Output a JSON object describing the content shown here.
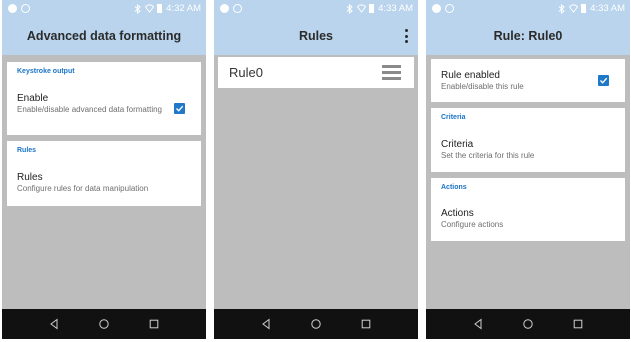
{
  "status_bar": {
    "time_1": "4:32 AM",
    "time_2": "4:33 AM",
    "time_3": "4:33 AM"
  },
  "screen1": {
    "title": "Advanced data formatting",
    "keystroke_section": "Keystroke output",
    "enable_title": "Enable",
    "enable_summary": "Enable/disable advanced data formatting",
    "enable_checked": true,
    "rules_section": "Rules",
    "rules_title": "Rules",
    "rules_summary": "Configure rules for data manipulation"
  },
  "screen2": {
    "title": "Rules",
    "rules": [
      "Rule0"
    ]
  },
  "screen3": {
    "title": "Rule: Rule0",
    "rule_enabled_title": "Rule enabled",
    "rule_enabled_summary": "Enable/disable this rule",
    "rule_enabled_checked": true,
    "criteria_section": "Criteria",
    "criteria_title": "Criteria",
    "criteria_summary": "Set the criteria for this rule",
    "actions_section": "Actions",
    "actions_title": "Actions",
    "actions_summary": "Configure actions"
  },
  "icons": {
    "status_left": [
      "notification-icon",
      "sync-icon"
    ],
    "status_right": [
      "bluetooth-icon",
      "wifi-icon",
      "battery-icon"
    ],
    "nav": [
      "back-icon",
      "home-icon",
      "recent-apps-icon"
    ],
    "overflow": "more-vert-icon",
    "drag": "drag-handle-icon",
    "check": "checkbox-checked-icon"
  },
  "colors": {
    "app_bar": "#b9d4ec",
    "accent": "#1f78c8",
    "background": "#bdbdbd",
    "nav_bar": "#111111"
  }
}
